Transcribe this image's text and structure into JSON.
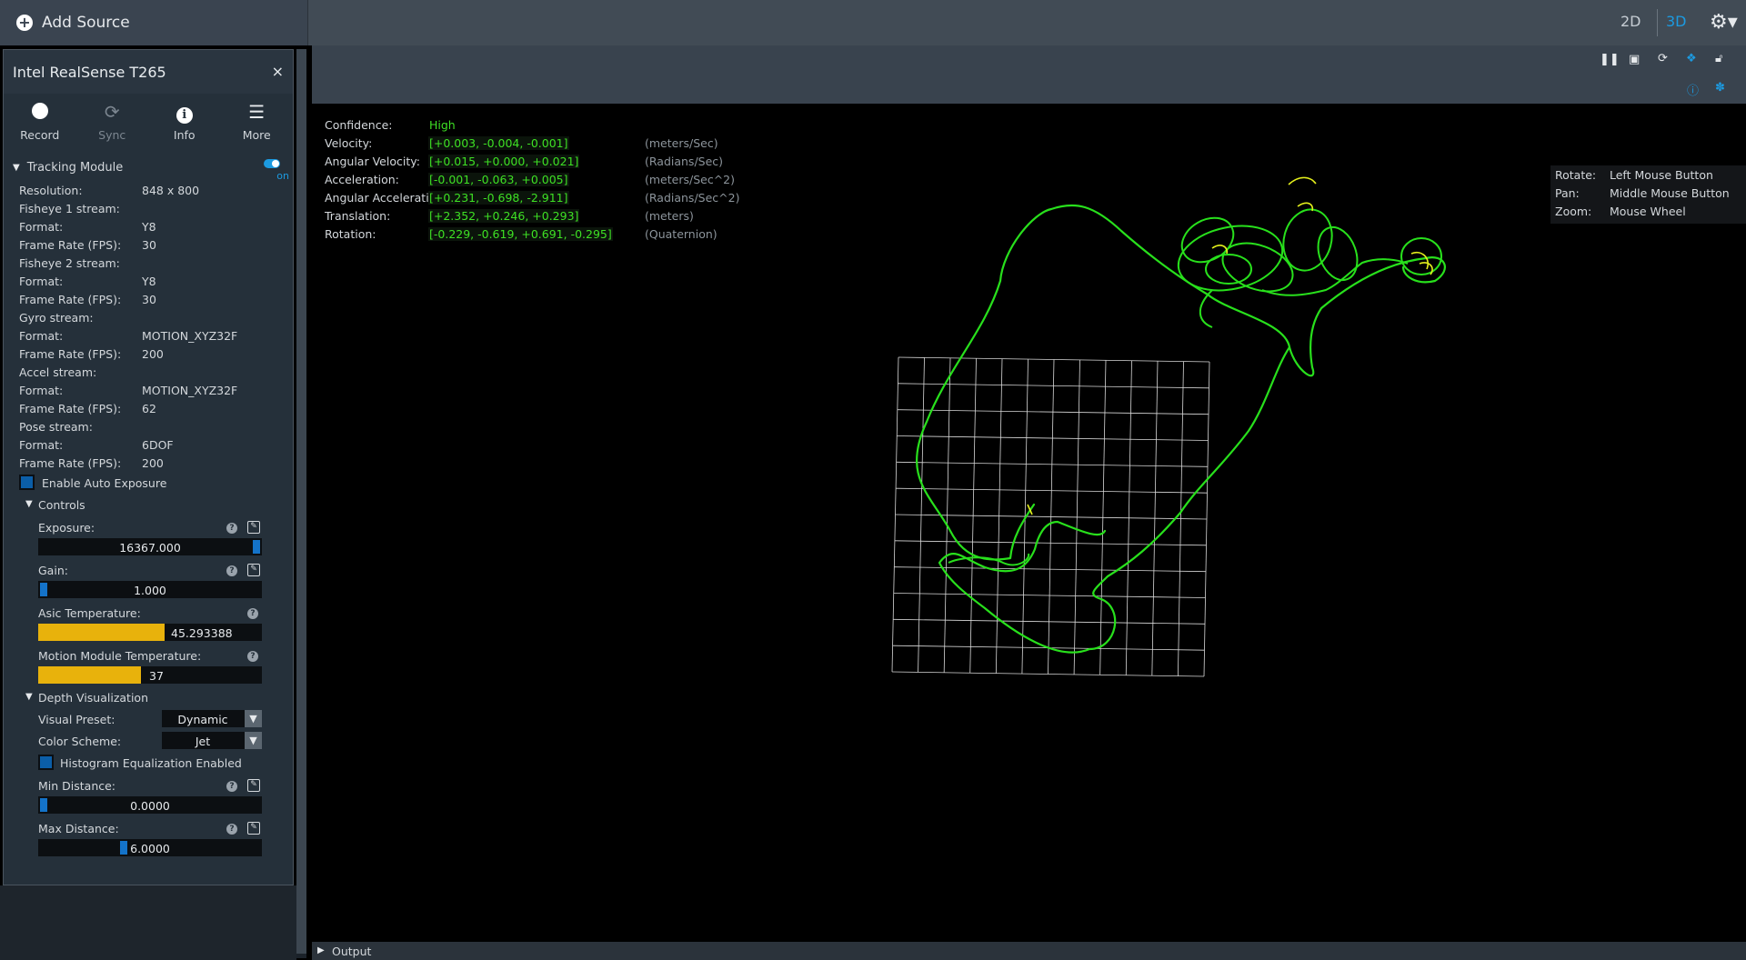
{
  "topbar": {
    "add_source": "Add Source",
    "view_2d": "2D",
    "view_3d": "3D",
    "accent": "#1c9ae0"
  },
  "device": {
    "title": "Intel RealSense T265",
    "close": "×",
    "buttons": [
      {
        "label": "Record",
        "icon": "record-icon"
      },
      {
        "label": "Sync",
        "icon": "sync-icon"
      },
      {
        "label": "Info",
        "icon": "info-icon"
      },
      {
        "label": "More",
        "icon": "menu-icon"
      }
    ]
  },
  "tracking": {
    "title": "Tracking Module",
    "toggle_label": "on",
    "rows": [
      {
        "k": "Resolution:",
        "v": "848 x 800"
      },
      {
        "k": "Fisheye 1 stream:",
        "v": ""
      },
      {
        "k": "Format:",
        "v": "Y8"
      },
      {
        "k": "Frame Rate (FPS):",
        "v": "30"
      },
      {
        "k": "Fisheye 2 stream:",
        "v": ""
      },
      {
        "k": "Format:",
        "v": "Y8"
      },
      {
        "k": "Frame Rate (FPS):",
        "v": "30"
      },
      {
        "k": "Gyro stream:",
        "v": ""
      },
      {
        "k": "Format:",
        "v": "MOTION_XYZ32F"
      },
      {
        "k": "Frame Rate (FPS):",
        "v": "200"
      },
      {
        "k": "Accel stream:",
        "v": ""
      },
      {
        "k": "Format:",
        "v": "MOTION_XYZ32F"
      },
      {
        "k": "Frame Rate (FPS):",
        "v": "62"
      },
      {
        "k": "Pose stream:",
        "v": ""
      },
      {
        "k": "Format:",
        "v": "6DOF"
      },
      {
        "k": "Frame Rate (FPS):",
        "v": "200"
      }
    ],
    "auto_exposure": "Enable Auto Exposure"
  },
  "controls": {
    "title": "Controls",
    "exposure": {
      "label": "Exposure:",
      "value": "16367.000"
    },
    "gain": {
      "label": "Gain:",
      "value": "1.000"
    },
    "asic_temp": {
      "label": "Asic Temperature:",
      "value": "45.293388"
    },
    "motion_temp": {
      "label": "Motion Module Temperature:",
      "value": "37"
    }
  },
  "depth_vis": {
    "title": "Depth Visualization",
    "visual_preset": {
      "label": "Visual Preset:",
      "value": "Dynamic"
    },
    "color_scheme": {
      "label": "Color Scheme:",
      "value": "Jet"
    },
    "histogram": "Histogram Equalization Enabled",
    "min_distance": {
      "label": "Min Distance:",
      "value": "0.0000"
    },
    "max_distance": {
      "label": "Max Distance:",
      "value": "6.0000"
    }
  },
  "pose": [
    {
      "k": "Confidence:",
      "v": "High",
      "u": ""
    },
    {
      "k": "Velocity:",
      "v": "[+0.003, -0.004, -0.001]",
      "u": "(meters/Sec)"
    },
    {
      "k": "Angular Velocity:",
      "v": "[+0.015, +0.000, +0.021]",
      "u": "(Radians/Sec)"
    },
    {
      "k": "Acceleration:",
      "v": "[-0.001, -0.063, +0.005]",
      "u": "(meters/Sec^2)"
    },
    {
      "k": "Angular Acceleration:",
      "v": "[+0.231, -0.698, -2.911]",
      "u": "(Radians/Sec^2)"
    },
    {
      "k": "Translation:",
      "v": "[+2.352, +0.246, +0.293]",
      "u": "(meters)"
    },
    {
      "k": "Rotation:",
      "v": "[-0.229, -0.619, +0.691, -0.295]",
      "u": "(Quaternion)"
    }
  ],
  "mouse_help": [
    {
      "k": "Rotate:",
      "v": "Left Mouse Button"
    },
    {
      "k": "Pan:",
      "v": "Middle Mouse Button"
    },
    {
      "k": "Zoom:",
      "v": "Mouse Wheel"
    }
  ],
  "output": {
    "label": "Output"
  },
  "colors": {
    "trajectory": "#28e01c",
    "highlight": "#e4f01c",
    "temp_bar": "#e8b20c",
    "grid": "#d8d8d8"
  }
}
